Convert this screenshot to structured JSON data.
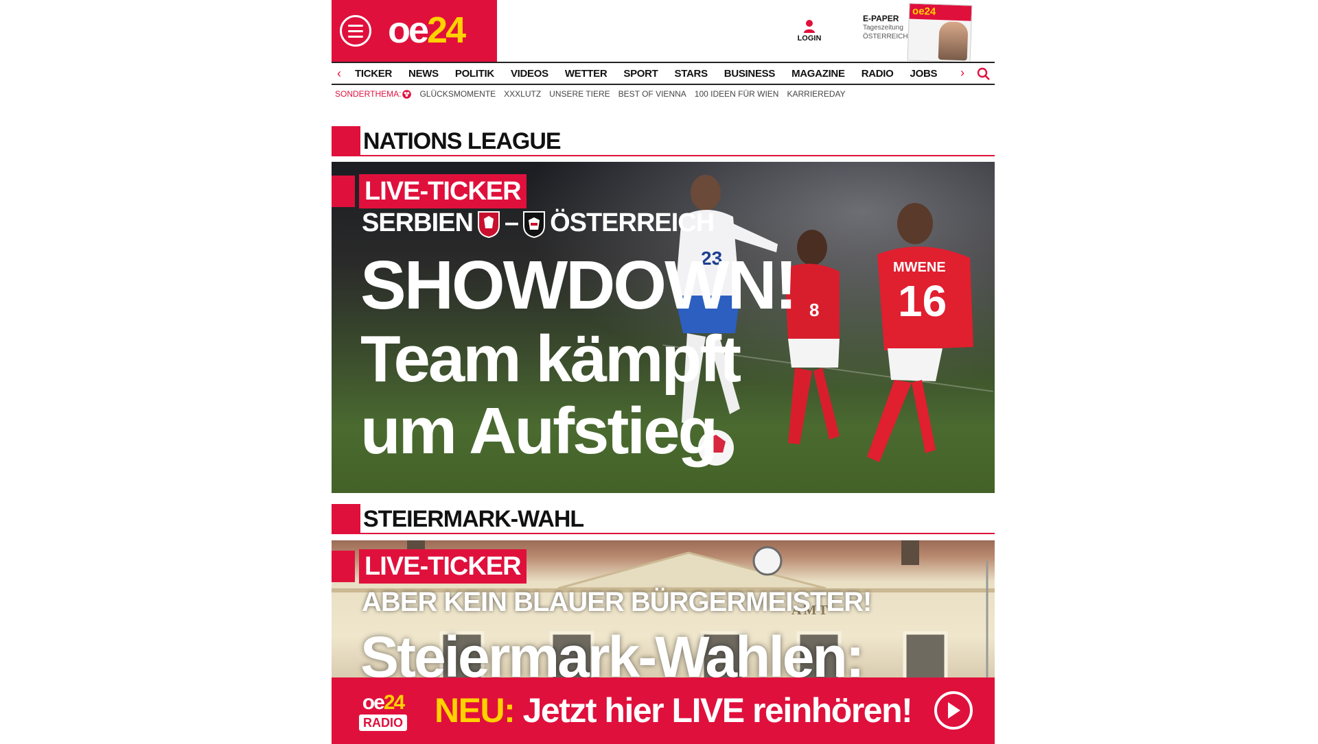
{
  "brand": {
    "logo_main": "oe",
    "logo_accent": "24",
    "accent_color": "#e0103c",
    "highlight_color": "#ffd200"
  },
  "header": {
    "menu_icon": "hamburger-menu-icon",
    "login_label": "LOGIN",
    "epaper": {
      "title": "E-PAPER",
      "line1": "Tageszeitung",
      "line2": "ÖSTERREICH"
    }
  },
  "nav": {
    "items": [
      "TICKER",
      "NEWS",
      "POLITIK",
      "VIDEOS",
      "WETTER",
      "SPORT",
      "STARS",
      "BUSINESS",
      "MAGAZINE",
      "RADIO",
      "JOBS"
    ]
  },
  "subnav": {
    "sonder_label": "SONDERTHEMA:",
    "links": [
      "GLÜCKSMOMENTE",
      "XXXLUTZ",
      "UNSERE TIERE",
      "BEST OF VIENNA",
      "100 IDEEN FÜR WIEN",
      "KARRIEREDAY"
    ]
  },
  "sections": [
    {
      "title": "NATIONS LEAGUE",
      "live_tag": "LIVE-TICKER",
      "kicker_left": "SERBIEN",
      "kicker_sep": "–",
      "kicker_right": "ÖSTERREICH",
      "headline_1": "SHOWDOWN!",
      "headline_2": "Team kämpft",
      "headline_3": "um Aufstieg",
      "jersey_number_white": "23",
      "jersey_name_red": "MWENE",
      "jersey_number_red": "16",
      "jersey_number_red2": "8"
    },
    {
      "title": "STEIERMARK-WAHL",
      "live_tag": "LIVE-TICKER",
      "kicker": "ABER KEIN BLAUER BÜRGERMEISTER!",
      "headline_1": "Steiermark-Wahlen:",
      "building_sign": "AMT"
    }
  ],
  "radio_banner": {
    "logo_main": "oe",
    "logo_accent": "24",
    "logo_sub": "RADIO",
    "neu": "NEU:",
    "text": "Jetzt hier LIVE reinhören!"
  }
}
